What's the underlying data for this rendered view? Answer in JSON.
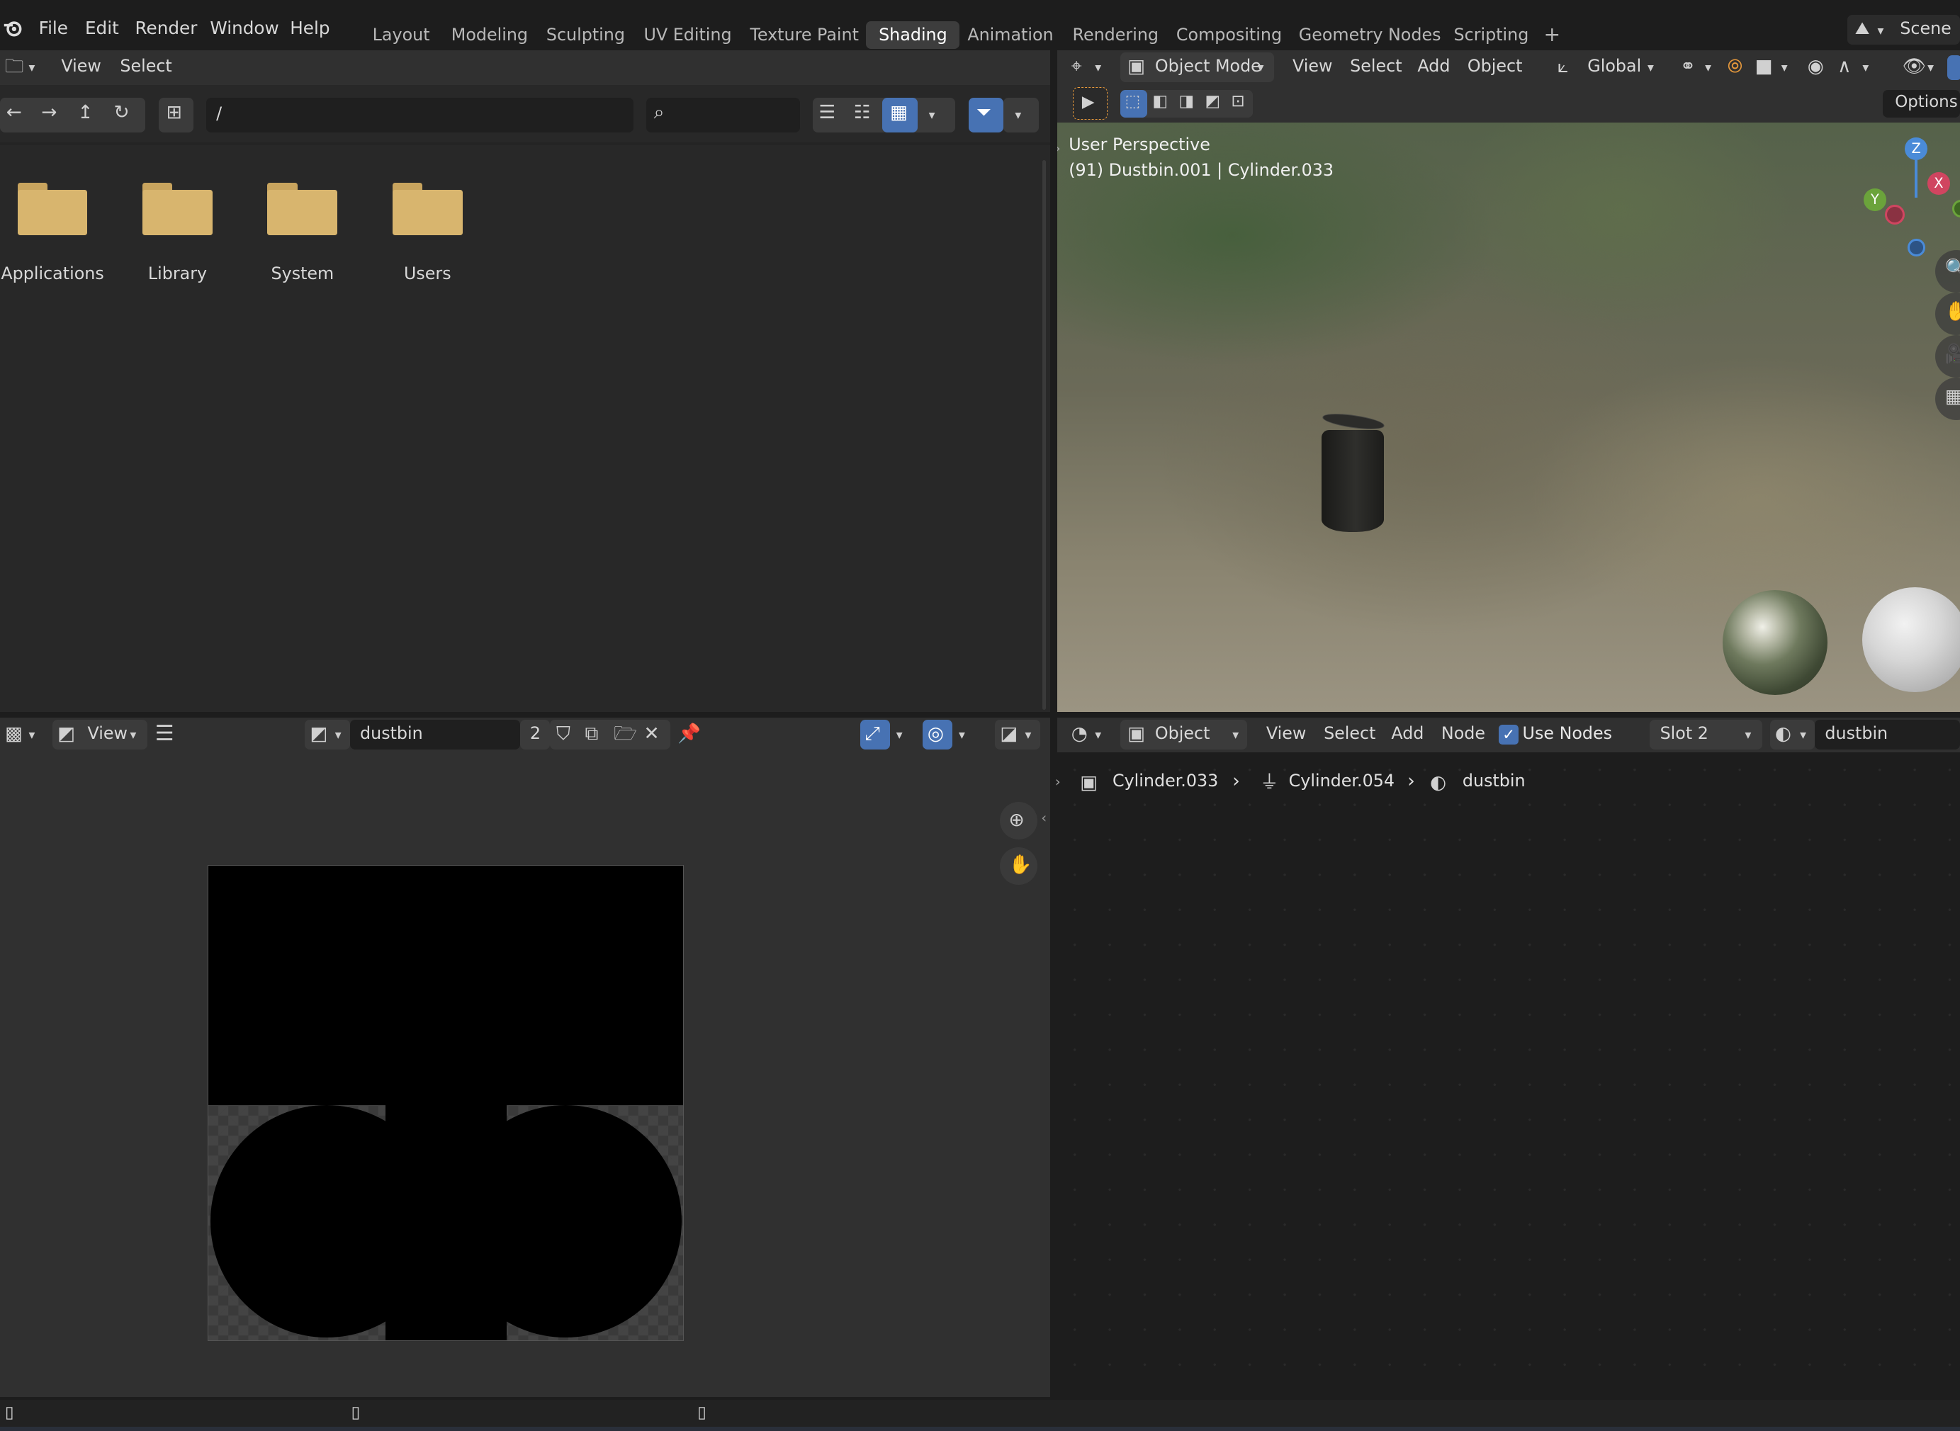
{
  "topbar": {
    "menus": [
      "File",
      "Edit",
      "Render",
      "Window",
      "Help"
    ],
    "workspaces": [
      "Layout",
      "Modeling",
      "Sculpting",
      "UV Editing",
      "Texture Paint",
      "Shading",
      "Animation",
      "Rendering",
      "Compositing",
      "Geometry Nodes",
      "Scripting"
    ],
    "active_workspace": "Shading",
    "add_tab": "+",
    "scene_label": "Scene"
  },
  "file_browser": {
    "header_menus": [
      "View",
      "Select"
    ],
    "path": "/",
    "search_placeholder": "",
    "folders": [
      "Applications",
      "Library",
      "System",
      "Users"
    ]
  },
  "viewport": {
    "mode": "Object Mode",
    "menus": [
      "View",
      "Select",
      "Add",
      "Object"
    ],
    "transform_orientation": "Global",
    "options_label": "Options",
    "view_name": "User Perspective",
    "object_info": "(91) Dustbin.001 | Cylinder.033",
    "gizmo_axes": [
      "Z",
      "X",
      "Y"
    ]
  },
  "image_editor": {
    "view_label": "View",
    "image_name": "dustbin",
    "user_count": "2"
  },
  "node_editor": {
    "type": "Object",
    "menus": [
      "View",
      "Select",
      "Add",
      "Node"
    ],
    "use_nodes_label": "Use Nodes",
    "use_nodes_checked": true,
    "slot": "Slot 2",
    "material": "dustbin",
    "breadcrumb": [
      "Cylinder.033",
      "Cylinder.054",
      "dustbin"
    ]
  },
  "colors": {
    "accent_blue": "#4772b3",
    "folder": "#d8b56e",
    "panel_bg": "#282828",
    "header_bg": "#303030"
  }
}
